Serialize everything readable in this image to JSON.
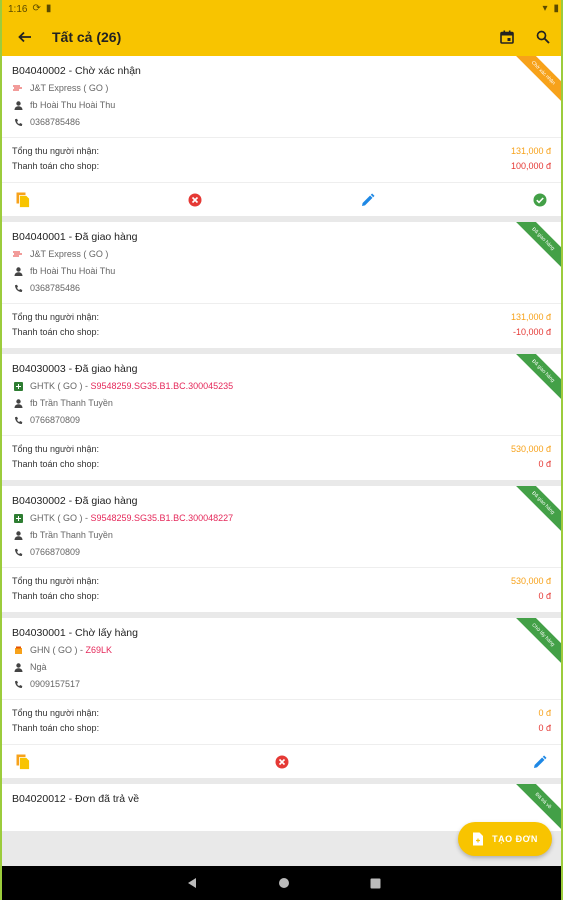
{
  "status_bar": {
    "time": "1:16"
  },
  "app_bar": {
    "title": "Tất cả (26)"
  },
  "labels": {
    "total_receiver": "Tổng thu người nhận:",
    "shop_payment": "Thanh toán cho shop:"
  },
  "orders": [
    {
      "code": "B04040002 - Chờ xác nhận",
      "carrier": "J&T Express ( GO )",
      "tracking": "",
      "customer": "fb Hoài Thu Hoài Thu",
      "phone": "0368785486",
      "total": "131,000 đ",
      "shop": "100,000 đ",
      "ribbon": "Chờ xác nhận",
      "ribbon_color": "#f7a21a"
    },
    {
      "code": "B04040001 - Đã giao hàng",
      "carrier": "J&T Express ( GO )",
      "tracking": "",
      "customer": "fb Hoài Thu Hoài Thu",
      "phone": "0368785486",
      "total": "131,000 đ",
      "shop": "-10,000 đ",
      "ribbon": "Đã giao hàng",
      "ribbon_color": "#43a047"
    },
    {
      "code": "B04030003 - Đã giao hàng",
      "carrier": "GHTK ( GO )",
      "tracking": "S9548259.SG35.B1.BC.300045235",
      "customer": "fb Trần Thanh Tuyền",
      "phone": "0766870809",
      "total": "530,000 đ",
      "shop": "0 đ",
      "ribbon": "Đã giao hàng",
      "ribbon_color": "#43a047"
    },
    {
      "code": "B04030002 - Đã giao hàng",
      "carrier": "GHTK ( GO )",
      "tracking": "S9548259.SG35.B1.BC.300048227",
      "customer": "fb Trần Thanh Tuyền",
      "phone": "0766870809",
      "total": "530,000 đ",
      "shop": "0 đ",
      "ribbon": "Đã giao hàng",
      "ribbon_color": "#43a047"
    },
    {
      "code": "B04030001 - Chờ lấy hàng",
      "carrier": "GHN ( GO )",
      "tracking": "Z69LK",
      "customer": "Ngà",
      "phone": "0909157517",
      "total": "0 đ",
      "shop": "0 đ",
      "ribbon": "Chờ lấy hàng",
      "ribbon_color": "#43a047"
    },
    {
      "code": "B04020012 - Đơn đã trả về",
      "ribbon": "Đã trả về",
      "ribbon_color": "#43a047"
    }
  ],
  "fab": {
    "label": "TẠO ĐƠN"
  },
  "colors": {
    "accent": "#f8c400",
    "total_orange": "#f7a21a",
    "red": "#e53935",
    "blue": "#1e88e5",
    "green": "#43a047",
    "tracking_pink": "#e5285a"
  }
}
